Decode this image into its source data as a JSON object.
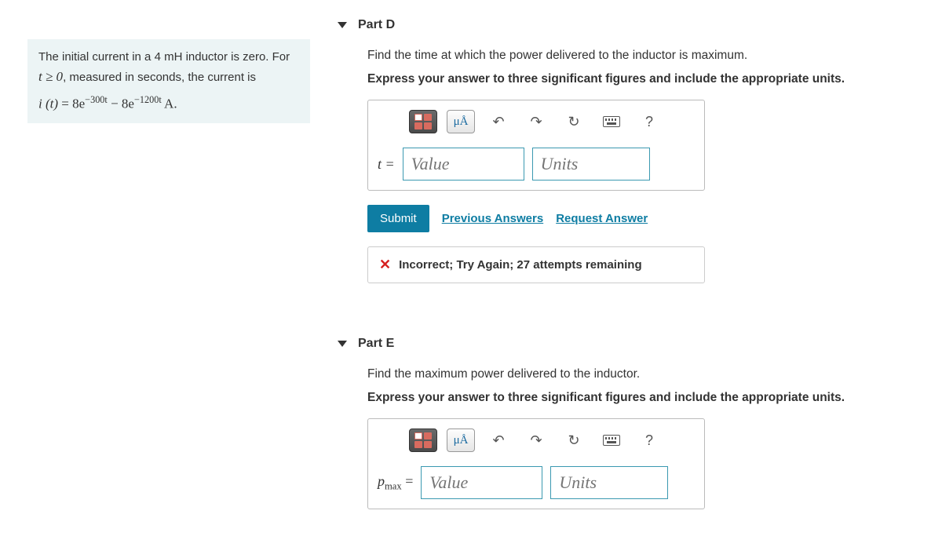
{
  "prompt": {
    "line1": "The initial current in a 4 mH inductor is zero. For",
    "line2_prefix": "t ≥ 0",
    "line2_suffix": ", measured in seconds, the current is",
    "eq_lhs": "i (t)",
    "eq_eq": "  =  ",
    "eq_t1": "8e",
    "eq_exp1": "−300t",
    "eq_minus": " − ",
    "eq_t2": "8e",
    "eq_exp2": "−1200t",
    "eq_unit": " A."
  },
  "parts": {
    "D": {
      "title": "Part D",
      "instruction": "Find the time at which the power delivered to the inductor is maximum.",
      "express": "Express your answer to three significant figures and include the appropriate units.",
      "lhs": "t =",
      "value_ph": "Value",
      "units_ph": "Units",
      "submit": "Submit",
      "prev_link": "Previous Answers",
      "req_link": "Request Answer",
      "feedback": "Incorrect; Try Again; 27 attempts remaining"
    },
    "E": {
      "title": "Part E",
      "instruction": "Find the maximum power delivered to the inductor.",
      "express": "Express your answer to three significant figures and include the appropriate units.",
      "lhs_var": "p",
      "lhs_sub": "max",
      "lhs_eq": " =",
      "value_ph": "Value",
      "units_ph": "Units"
    }
  },
  "toolbar": {
    "units_btn": "μÅ",
    "undo": "↶",
    "redo": "↷",
    "reset": "↻",
    "help": "?"
  }
}
